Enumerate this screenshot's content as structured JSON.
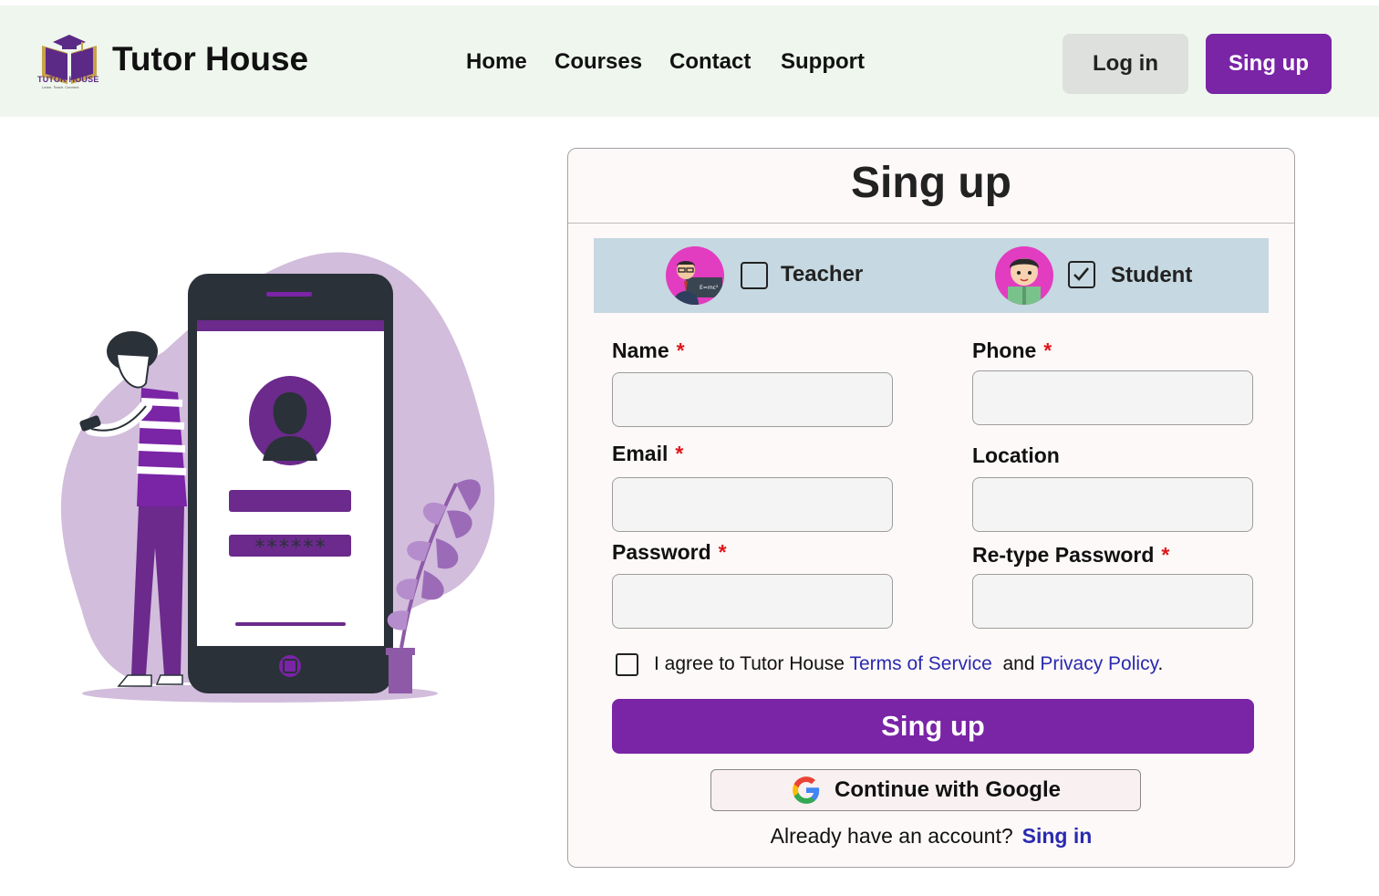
{
  "header": {
    "logo_text": "TUTOR HOUSE",
    "logo_sub": "Learn. Teach. Connect.",
    "brand": "Tutor House",
    "nav": [
      "Home",
      "Courses",
      "Contact",
      "Support"
    ],
    "login_label": "Log in",
    "signup_label": "Sing up"
  },
  "illustration": {
    "password_mask": "******"
  },
  "form": {
    "title": "Sing up",
    "roles": [
      {
        "label": "Teacher",
        "checked": false
      },
      {
        "label": "Student",
        "checked": true
      }
    ],
    "fields": {
      "name": {
        "label": "Name",
        "required": "*",
        "value": ""
      },
      "phone": {
        "label": "Phone",
        "required": "*",
        "value": ""
      },
      "email": {
        "label": "Email",
        "required": "*",
        "value": ""
      },
      "location": {
        "label": "Location",
        "value": ""
      },
      "password": {
        "label": "Password",
        "required": "*",
        "value": ""
      },
      "retype_password": {
        "label": "Re-type Password",
        "required": "*",
        "value": ""
      }
    },
    "agree": {
      "prefix": "I agree to Tutor House",
      "terms": "Terms of Service",
      "and": "and",
      "privacy": "Privacy Policy",
      "suffix": ".",
      "checked": false
    },
    "submit_label": "Sing up",
    "google_label": "Continue with Google",
    "already_text": "Already have an account?",
    "signin_label": "Sing in"
  },
  "colors": {
    "accent": "#7a24a6",
    "header_bg": "#eff6ee",
    "role_bar_bg": "#c6d8e1",
    "link": "#2a2ab0",
    "required": "#e0171c"
  }
}
